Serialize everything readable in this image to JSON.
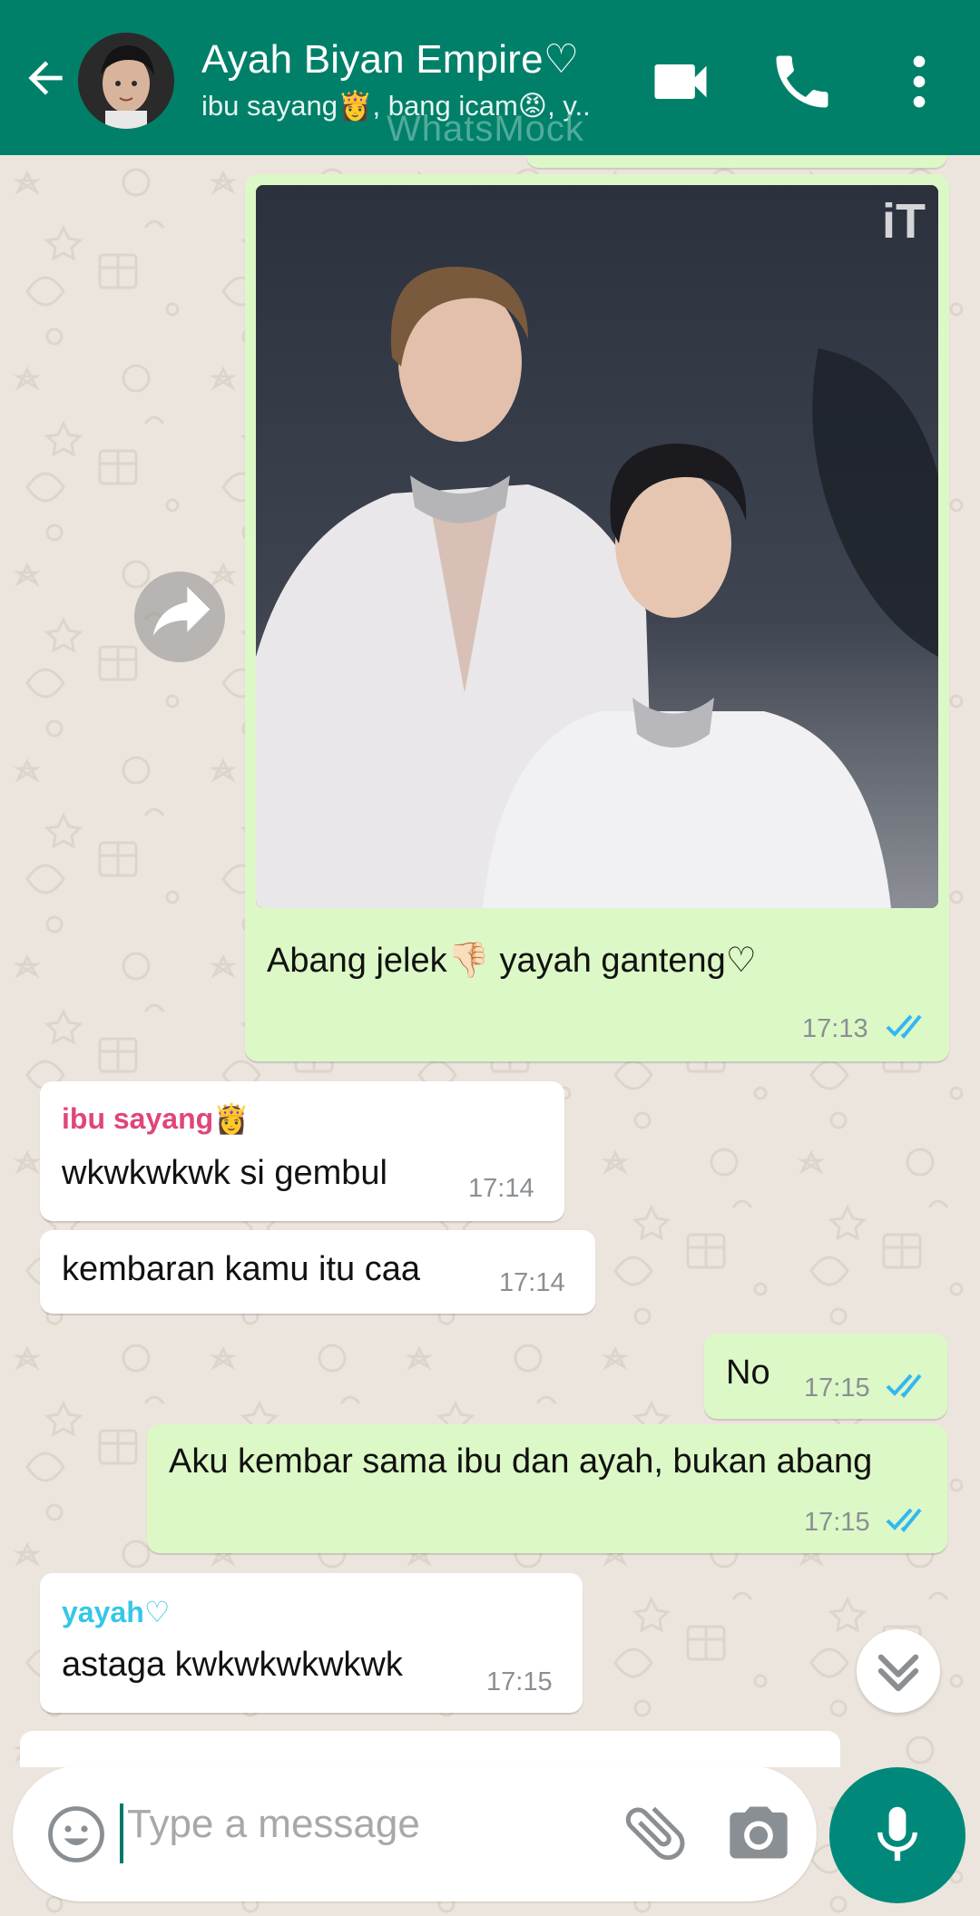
{
  "header": {
    "title": "Ayah Biyan Empire♡",
    "subtitle": "ibu sayang👸, bang icam😡, y..",
    "watermark": "WhatsMock",
    "icons": [
      "back-arrow-icon",
      "avatar",
      "video-call-icon",
      "phone-icon",
      "more-vert-icon"
    ]
  },
  "colors": {
    "header": "#008069",
    "outgoing": "#dcf8c6",
    "incoming": "#ffffff",
    "chat_bg": "#ece5dd",
    "tick_read": "#34b7f1",
    "mic": "#00897b",
    "sender_ibu": "#e0457b",
    "sender_yayah": "#35c7e6"
  },
  "messages": [
    {
      "id": "m1",
      "direction": "out",
      "type": "image",
      "caption": "Abang jelek👎🏻 yayah ganteng♡",
      "time": "17:13",
      "status": "read",
      "image_badge": "iT"
    },
    {
      "id": "m2",
      "direction": "in",
      "sender": "ibu sayang👸",
      "text": "wkwkwkwk si gembul",
      "time": "17:14"
    },
    {
      "id": "m3",
      "direction": "in",
      "text": "kembaran kamu itu caa",
      "time": "17:14"
    },
    {
      "id": "m4",
      "direction": "out",
      "text": "No",
      "time": "17:15",
      "status": "read"
    },
    {
      "id": "m5",
      "direction": "out",
      "text": "Aku kembar sama ibu dan ayah, bukan abang",
      "time": "17:15",
      "status": "read"
    },
    {
      "id": "m6",
      "direction": "in",
      "sender": "yayah♡",
      "text": "astaga kwkwkwkwkwk",
      "time": "17:15"
    }
  ],
  "input": {
    "placeholder": "Type a message",
    "icons": [
      "emoji-icon",
      "attach-icon",
      "camera-icon",
      "mic-icon"
    ]
  }
}
